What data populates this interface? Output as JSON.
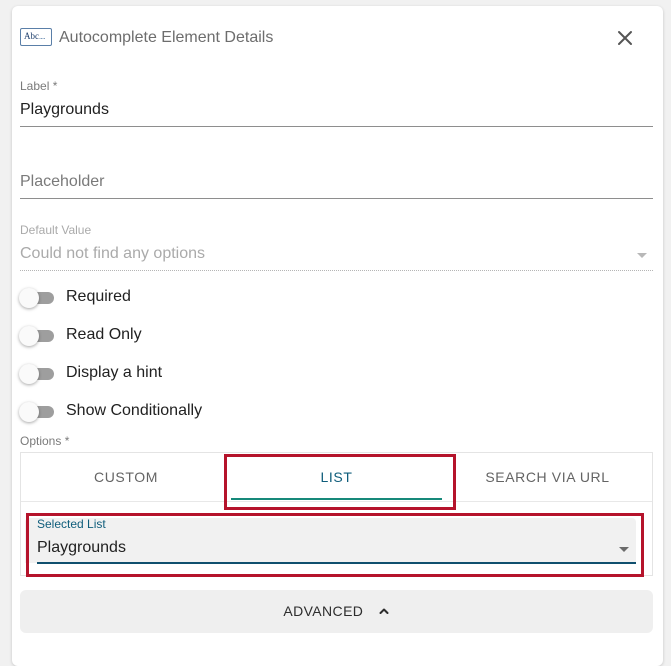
{
  "header": {
    "icon_text": "Abc",
    "icon_dots": "....",
    "title": "Autocomplete Element Details",
    "close_icon": "close-icon"
  },
  "label_field": {
    "label": "Label *",
    "value": "Playgrounds"
  },
  "placeholder_field": {
    "placeholder": "Placeholder",
    "value": ""
  },
  "default_value_field": {
    "label": "Default Value",
    "value": "Could not find any options",
    "disabled": true
  },
  "toggles": [
    {
      "label": "Required",
      "on": false
    },
    {
      "label": "Read Only",
      "on": false
    },
    {
      "label": "Display a hint",
      "on": false
    },
    {
      "label": "Show Conditionally",
      "on": false
    }
  ],
  "options": {
    "label": "Options *",
    "tabs": [
      {
        "label": "CUSTOM",
        "active": false
      },
      {
        "label": "LIST",
        "active": true
      },
      {
        "label": "SEARCH VIA URL",
        "active": false
      }
    ],
    "selected_list": {
      "label": "Selected List",
      "value": "Playgrounds"
    }
  },
  "advanced": {
    "label": "ADVANCED",
    "icon": "chevron-up-icon"
  },
  "colors": {
    "accent_teal": "#16897a",
    "accent_blue": "#0f5d7b",
    "highlight_red": "#b5132b"
  }
}
